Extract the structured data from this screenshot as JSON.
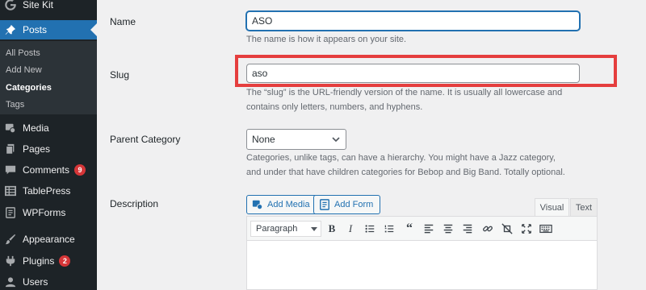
{
  "sidebar": {
    "items": [
      {
        "label": "Site Kit",
        "icon": "google-g-icon"
      },
      {
        "label": "Posts",
        "icon": "pushpin-icon"
      },
      {
        "label": "Media",
        "icon": "media-icon"
      },
      {
        "label": "Pages",
        "icon": "pages-icon"
      },
      {
        "label": "Comments",
        "icon": "comment-icon",
        "badge": "9"
      },
      {
        "label": "TablePress",
        "icon": "table-icon"
      },
      {
        "label": "WPForms",
        "icon": "form-icon"
      },
      {
        "label": "Appearance",
        "icon": "paintbrush-icon"
      },
      {
        "label": "Plugins",
        "icon": "plug-icon",
        "badge": "2"
      },
      {
        "label": "Users",
        "icon": "user-icon"
      }
    ],
    "posts_submenu": [
      "All Posts",
      "Add New",
      "Categories",
      "Tags"
    ]
  },
  "form": {
    "name": {
      "label": "Name",
      "value": "ASO",
      "help": "The name is how it appears on your site."
    },
    "slug": {
      "label": "Slug",
      "value": "aso",
      "help": "The “slug” is the URL-friendly version of the name. It is usually all lowercase and contains only letters, numbers, and hyphens."
    },
    "parent": {
      "label": "Parent Category",
      "selected": "None",
      "help": "Categories, unlike tags, can have a hierarchy. You might have a Jazz category, and under that have children categories for Bebop and Big Band. Totally optional."
    },
    "description": {
      "label": "Description"
    }
  },
  "editor": {
    "add_media": "Add Media",
    "add_form": "Add Form",
    "tab_visual": "Visual",
    "tab_text": "Text",
    "format_select": "Paragraph",
    "toolbar_icons": [
      "bold-icon",
      "italic-icon",
      "bulleted-list-icon",
      "numbered-list-icon",
      "blockquote-icon",
      "align-left-icon",
      "align-center-icon",
      "align-right-icon",
      "link-icon",
      "unlink-icon",
      "fullscreen-icon",
      "toolbar-toggle-icon"
    ]
  },
  "colors": {
    "accent": "#2271b1",
    "sidebar": "#1d2327",
    "highlight": "#e53e3e",
    "badge": "#d63638"
  }
}
